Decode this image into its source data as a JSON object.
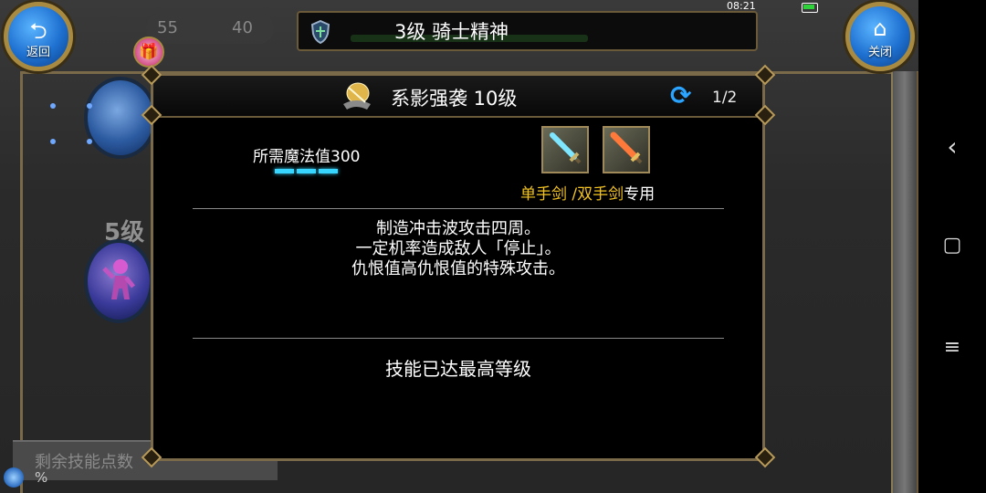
{
  "status_bar": {
    "time": "08:21"
  },
  "top_bar": {
    "back_label": "返回",
    "close_label": "关闭",
    "title": "3级 骑士精神",
    "stat_left": "55",
    "stat_right": "40"
  },
  "sidebar": {
    "level_text": "5级",
    "remaining_label": "剩余技能点数",
    "percent_symbol": "%"
  },
  "dialog": {
    "skill_name": "系影强袭 10级",
    "page": "1/2",
    "mana_required": "所需魔法值300",
    "mana_segments": 3,
    "weapon_use": {
      "part1": "单手剑 /双手剑",
      "part2": "专用"
    },
    "description": [
      "制造冲击波攻击四周。",
      "一定机率造成敌人「停止」。",
      "仇恨值高仇恨值的特殊攻击。"
    ],
    "max_level_text": "技能已达最高等级"
  },
  "nav_bar": {
    "back_icon": "‹",
    "home_icon": "▢",
    "menu_icon": "≡"
  },
  "colors": {
    "accent_yellow": "#f2c322",
    "mana_cyan": "#38d6ff",
    "refresh_blue": "#2aa4ff"
  }
}
